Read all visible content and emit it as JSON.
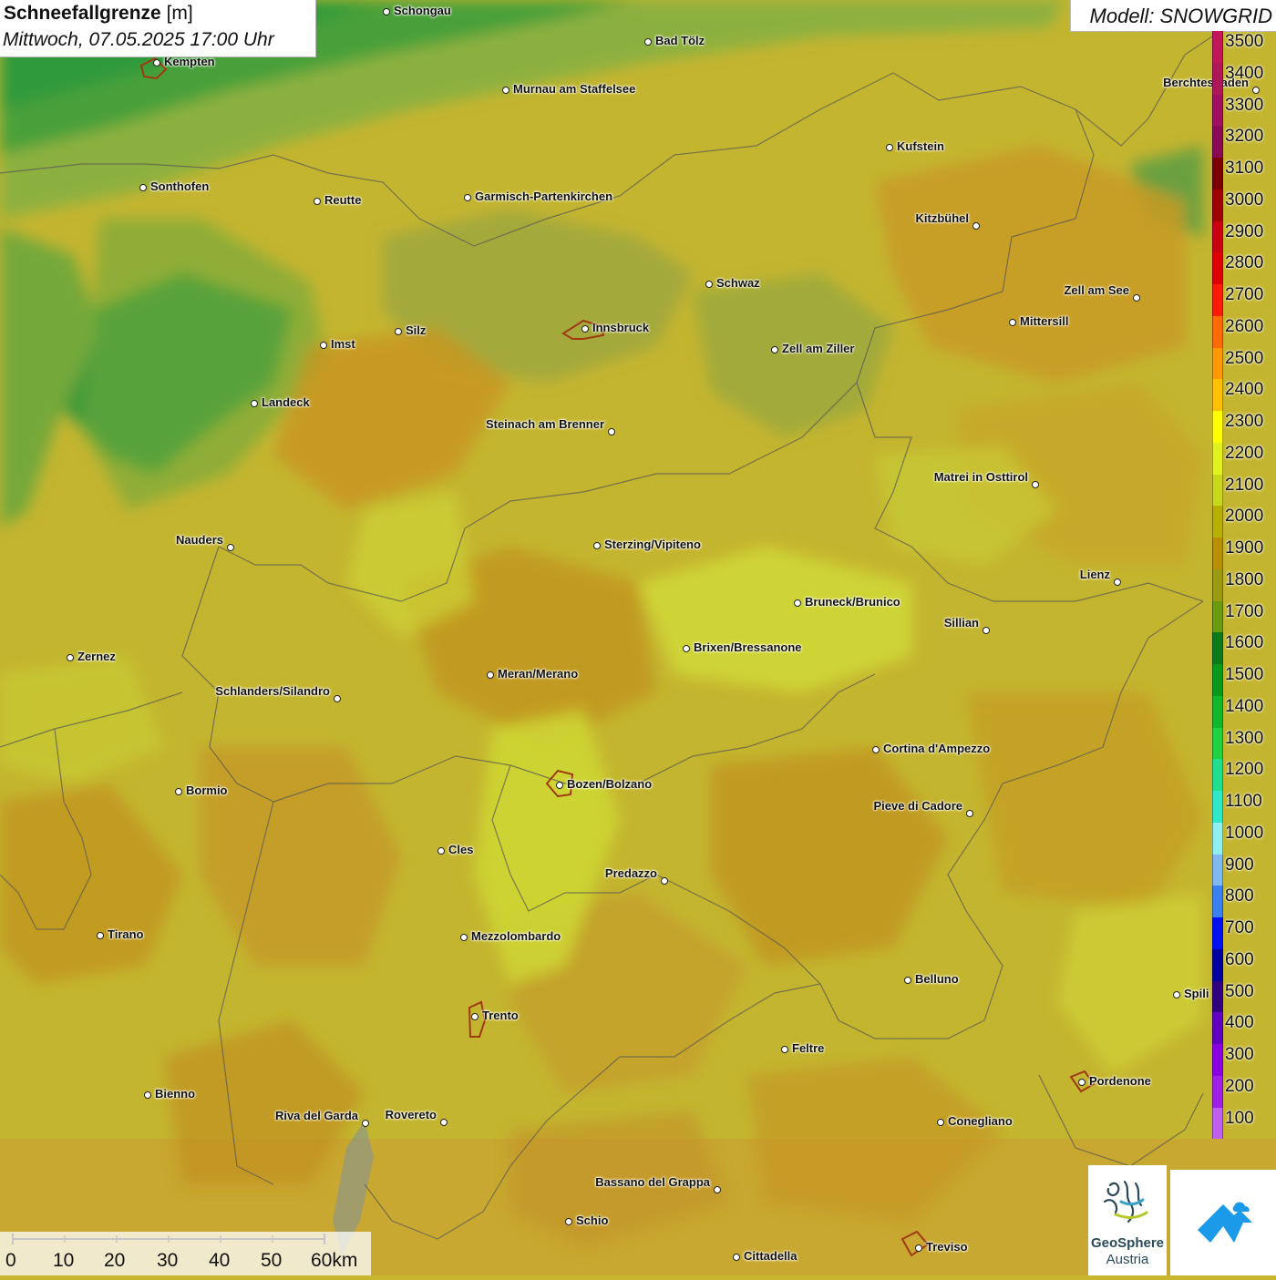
{
  "header": {
    "title": "Schneefallgrenze",
    "unit": "[m]",
    "datetime": "Mittwoch, 07.05.2025 17:00 Uhr"
  },
  "model": {
    "label": "Modell: SNOWGRID"
  },
  "legend": {
    "items": [
      {
        "label": "3500",
        "color": "#c2185b"
      },
      {
        "label": "3400",
        "color": "#b0175a"
      },
      {
        "label": "3300",
        "color": "#a01060"
      },
      {
        "label": "3200",
        "color": "#8a0a55"
      },
      {
        "label": "3100",
        "color": "#7a0000"
      },
      {
        "label": "3000",
        "color": "#a00000"
      },
      {
        "label": "2900",
        "color": "#c80010"
      },
      {
        "label": "2800",
        "color": "#e00000"
      },
      {
        "label": "2700",
        "color": "#ff1a00"
      },
      {
        "label": "2600",
        "color": "#ff6a00"
      },
      {
        "label": "2500",
        "color": "#ff9900"
      },
      {
        "label": "2400",
        "color": "#ffc000"
      },
      {
        "label": "2300",
        "color": "#ffff00"
      },
      {
        "label": "2200",
        "color": "#e2f21a"
      },
      {
        "label": "2100",
        "color": "#c8d81a"
      },
      {
        "label": "2000",
        "color": "#b8b000"
      },
      {
        "label": "1900",
        "color": "#b89000"
      },
      {
        "label": "1800",
        "color": "#9a9a10"
      },
      {
        "label": "1700",
        "color": "#6a9a10"
      },
      {
        "label": "1600",
        "color": "#0a7a1a"
      },
      {
        "label": "1500",
        "color": "#0a9a1a"
      },
      {
        "label": "1400",
        "color": "#10b82a"
      },
      {
        "label": "1300",
        "color": "#20d040"
      },
      {
        "label": "1200",
        "color": "#20e090"
      },
      {
        "label": "1100",
        "color": "#30e8c8"
      },
      {
        "label": "1000",
        "color": "#90f0f0"
      },
      {
        "label": "900",
        "color": "#80b8f0"
      },
      {
        "label": "800",
        "color": "#3a80f0"
      },
      {
        "label": "700",
        "color": "#0010f0"
      },
      {
        "label": "600",
        "color": "#0000a0"
      },
      {
        "label": "500",
        "color": "#300080"
      },
      {
        "label": "400",
        "color": "#6000c0"
      },
      {
        "label": "300",
        "color": "#8a00e0"
      },
      {
        "label": "200",
        "color": "#a020e8"
      },
      {
        "label": "100",
        "color": "#c060f0"
      }
    ]
  },
  "scale": {
    "ticks": [
      "0",
      "10",
      "20",
      "30",
      "40",
      "50",
      "60km"
    ]
  },
  "logos": {
    "geosphere_line1": "GeoSphere",
    "geosphere_line2": "Austria"
  },
  "cities": [
    {
      "name": "Schongau"
    },
    {
      "name": "Bad Tölz"
    },
    {
      "name": "Kempten"
    },
    {
      "name": "Murnau am Staffelsee"
    },
    {
      "name": "Berchtesgaden"
    },
    {
      "name": "Kufstein"
    },
    {
      "name": "Sonthofen"
    },
    {
      "name": "Reutte"
    },
    {
      "name": "Garmisch-Partenkirchen"
    },
    {
      "name": "Kitzbühel"
    },
    {
      "name": "Schwaz"
    },
    {
      "name": "Zell am See"
    },
    {
      "name": "Mittersill"
    },
    {
      "name": "Innsbruck"
    },
    {
      "name": "Imst"
    },
    {
      "name": "Silz"
    },
    {
      "name": "Zell am Ziller"
    },
    {
      "name": "Landeck"
    },
    {
      "name": "Steinach am Brenner"
    },
    {
      "name": "Matrei in Osttirol"
    },
    {
      "name": "Nauders"
    },
    {
      "name": "Sterzing/Vipiteno"
    },
    {
      "name": "Lienz"
    },
    {
      "name": "Bruneck/Brunico"
    },
    {
      "name": "Sillian"
    },
    {
      "name": "Zernez"
    },
    {
      "name": "Brixen/Bressanone"
    },
    {
      "name": "Meran/Merano"
    },
    {
      "name": "Schlanders/Silandro"
    },
    {
      "name": "Cortina d'Ampezzo"
    },
    {
      "name": "Bozen/Bolzano"
    },
    {
      "name": "Bormio"
    },
    {
      "name": "Pieve di Cadore"
    },
    {
      "name": "Cles"
    },
    {
      "name": "Predazzo"
    },
    {
      "name": "Tirano"
    },
    {
      "name": "Mezzolombardo"
    },
    {
      "name": "Belluno"
    },
    {
      "name": "Spili"
    },
    {
      "name": "Trento"
    },
    {
      "name": "Feltre"
    },
    {
      "name": "Pordenone"
    },
    {
      "name": "Bienno"
    },
    {
      "name": "Riva del Garda"
    },
    {
      "name": "Rovereto"
    },
    {
      "name": "Conegliano"
    },
    {
      "name": "Bassano del Grappa"
    },
    {
      "name": "Schio"
    },
    {
      "name": "Treviso"
    },
    {
      "name": "Cittadella"
    }
  ]
}
